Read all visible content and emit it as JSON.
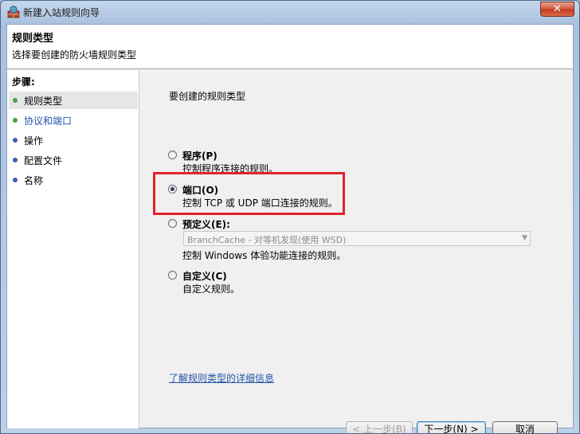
{
  "window": {
    "title": "新建入站规则向导",
    "close_glyph": "✕"
  },
  "header": {
    "title": "规则类型",
    "subtitle": "选择要创建的防火墙规则类型"
  },
  "steps": {
    "label": "步骤:",
    "items": [
      {
        "label": "规则类型",
        "dot_color": "#4aa14a",
        "current": true
      },
      {
        "label": "协议和端口",
        "dot_color": "#4aa14a",
        "current": false
      },
      {
        "label": "操作",
        "dot_color": "#3a5fb0",
        "current": false
      },
      {
        "label": "配置文件",
        "dot_color": "#3a5fb0",
        "current": false
      },
      {
        "label": "名称",
        "dot_color": "#3a5fb0",
        "current": false
      }
    ]
  },
  "content": {
    "prompt": "要创建的规则类型",
    "options": [
      {
        "title": "程序(P)",
        "desc": "控制程序连接的规则。",
        "selected": false
      },
      {
        "title": "端口(O)",
        "desc": "控制 TCP 或 UDP 端口连接的规则。",
        "selected": true
      },
      {
        "title": "预定义(E):",
        "desc": "控制 Windows 体验功能连接的规则。",
        "selected": false
      },
      {
        "title": "自定义(C)",
        "desc": "自定义规则。",
        "selected": false
      }
    ],
    "predefined_select": {
      "value": "BranchCache - 对等机发现(使用 WSD)",
      "enabled": false
    },
    "learn_more": "了解规则类型的详细信息"
  },
  "buttons": {
    "back": "< 上一步(B)",
    "next": "下一步(N) >",
    "cancel": "取消"
  },
  "colors": {
    "highlight": "#e0242c",
    "link": "#2255aa"
  }
}
